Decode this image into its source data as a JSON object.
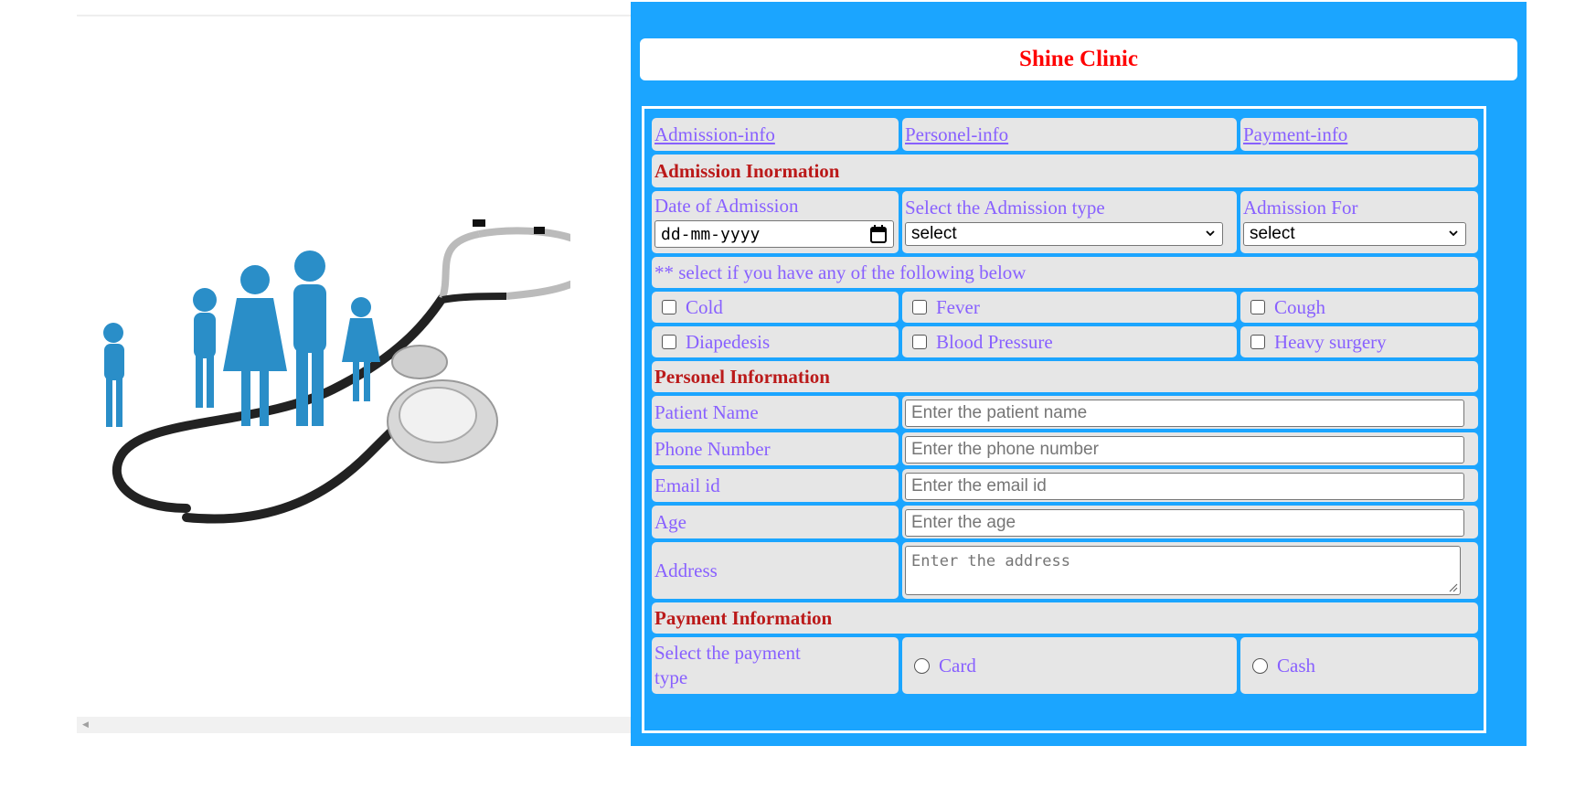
{
  "clinic": {
    "title": "Shine Clinic"
  },
  "tabs": [
    {
      "label": "Admission-info"
    },
    {
      "label": "Personel-info"
    },
    {
      "label": "Payment-info"
    }
  ],
  "admission": {
    "heading": "Admission Inormation",
    "date_label": "Date of Admission",
    "date_placeholder": "dd-mm-yyyy",
    "type_label": "Select the Admission type",
    "type_value": "select",
    "for_label": "Admission For",
    "for_value": "select",
    "symptoms_note": "** select if you have any of the following below",
    "symptoms": [
      "Cold",
      "Fever",
      "Cough",
      "Diapedesis",
      "Blood Pressure",
      "Heavy surgery"
    ]
  },
  "personal": {
    "heading": "Personel Information",
    "fields": [
      {
        "label": "Patient Name",
        "placeholder": "Enter the patient name"
      },
      {
        "label": "Phone Number",
        "placeholder": "Enter the phone number"
      },
      {
        "label": "Email id",
        "placeholder": "Enter the email id"
      },
      {
        "label": "Age",
        "placeholder": "Enter the age"
      },
      {
        "label": "Address",
        "placeholder": "Enter the address"
      }
    ]
  },
  "payment": {
    "heading": "Payment Information",
    "type_label": "Select the payment type",
    "options": [
      "Card",
      "Cash"
    ]
  },
  "colors": {
    "panel": "#1ba5ff",
    "title": "#ff0000",
    "heading": "#bb1a1a",
    "label": "#8860ff",
    "cell": "#e6e6e6"
  }
}
